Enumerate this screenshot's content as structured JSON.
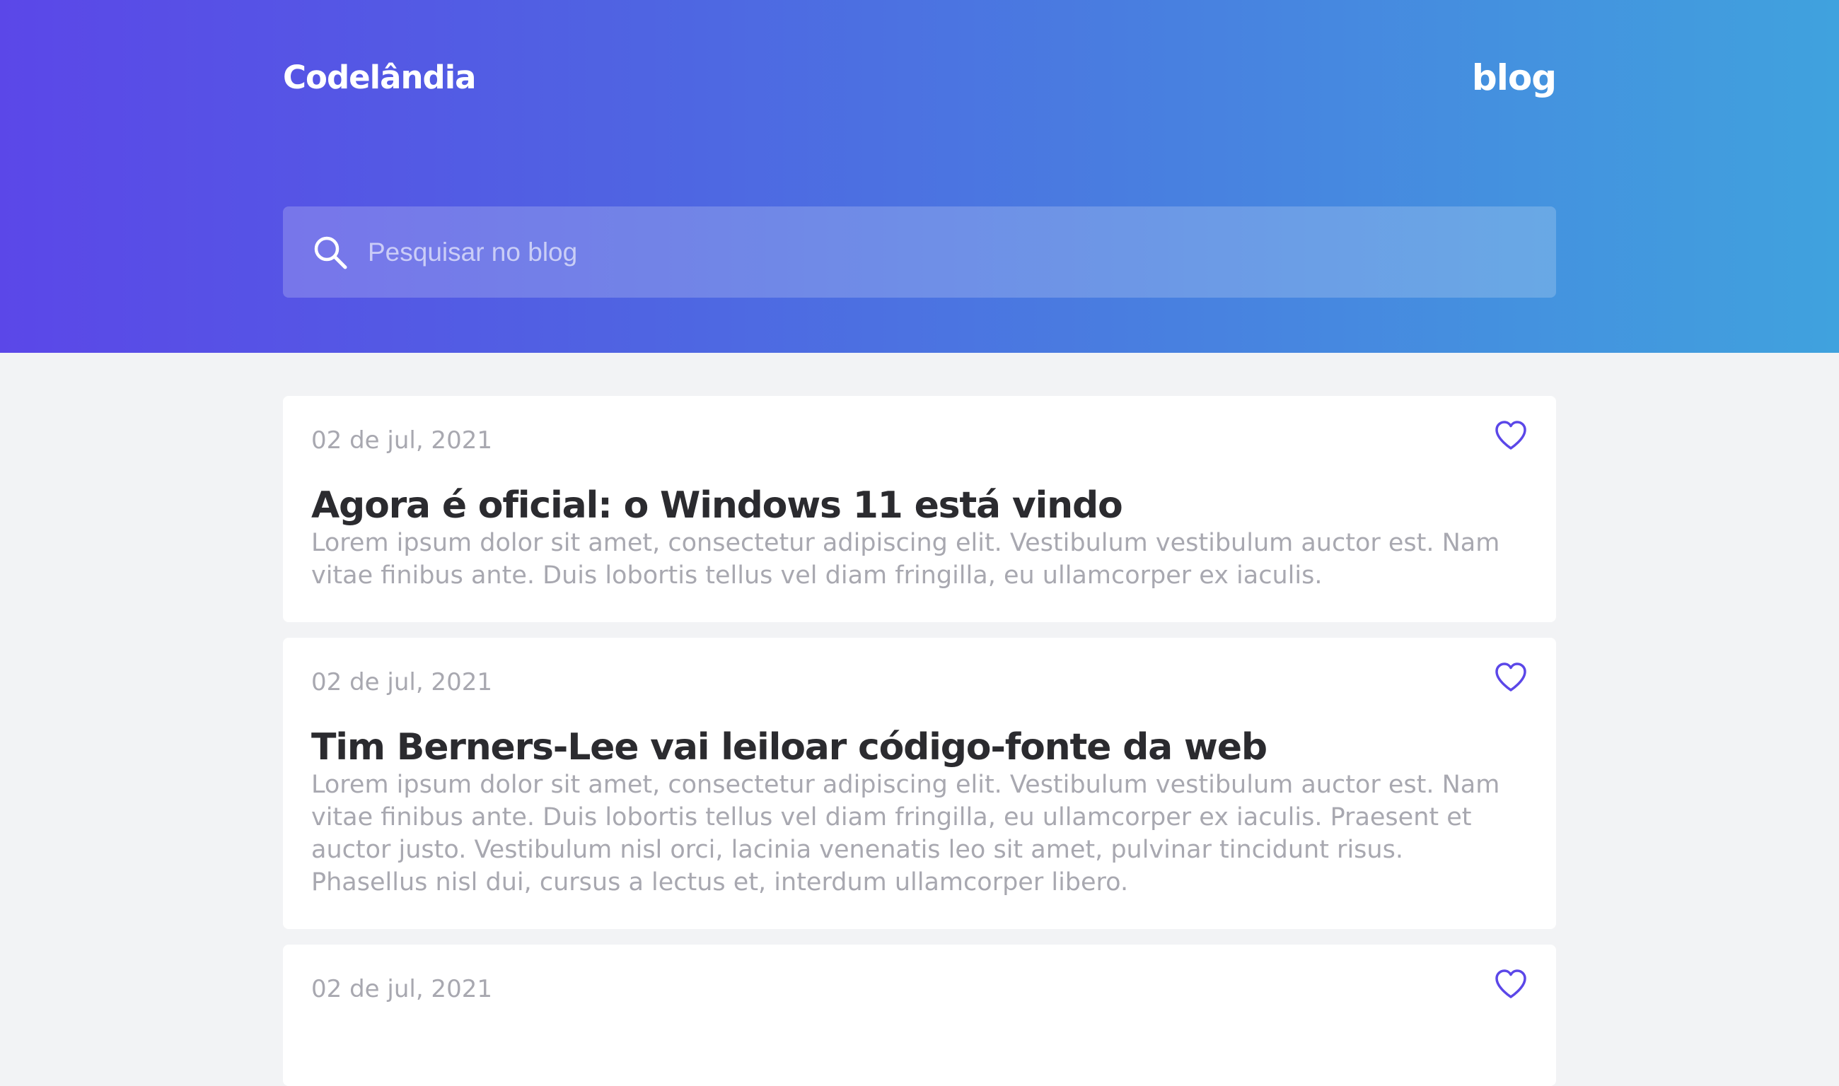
{
  "header": {
    "brand": "Codelândia",
    "nav_link": "blog",
    "gradient_start": "#5b47e8",
    "gradient_end": "#40a2de"
  },
  "search": {
    "placeholder": "Pesquisar no blog",
    "icon": "search-icon"
  },
  "accent_color": "#5b47e8",
  "posts": [
    {
      "date": "02 de jul, 2021",
      "title": "Agora é oficial: o Windows 11 está vindo",
      "excerpt": "Lorem ipsum dolor sit amet, consectetur adipiscing elit. Vestibulum vestibulum auctor est. Nam vitae finibus ante. Duis lobortis tellus vel diam fringilla, eu ullamcorper ex iaculis.",
      "icon": "heart-icon"
    },
    {
      "date": "02 de jul, 2021",
      "title": "Tim Berners-Lee vai leiloar código-fonte da web",
      "excerpt": "Lorem ipsum dolor sit amet, consectetur adipiscing elit. Vestibulum vestibulum auctor est. Nam vitae finibus ante. Duis lobortis tellus vel diam fringilla, eu ullamcorper ex iaculis. Praesent et auctor justo. Vestibulum nisl orci, lacinia venenatis leo sit amet, pulvinar tincidunt risus. Phasellus nisl dui, cursus a lectus et, interdum ullamcorper libero.",
      "icon": "heart-icon"
    },
    {
      "date": "02 de jul, 2021",
      "icon": "heart-icon"
    }
  ]
}
